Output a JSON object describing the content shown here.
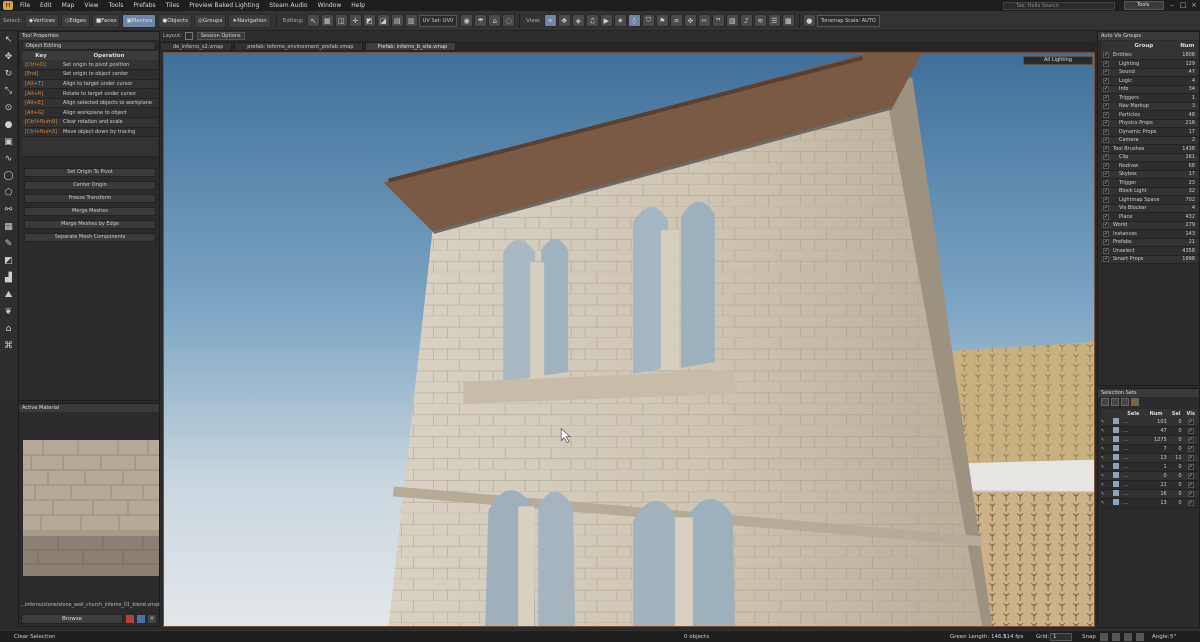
{
  "menu": {
    "items": [
      "File",
      "Edit",
      "Map",
      "View",
      "Tools",
      "Prefabs",
      "Tiles",
      "Preview Baked Lighting",
      "Steam Audio",
      "Window",
      "Help"
    ],
    "search_placeholder": "Tab: Hello Search",
    "tools_label": "Tools"
  },
  "toolbar": {
    "select_label": "Select:",
    "modes": [
      {
        "label": "Vertices",
        "icon": "vertex-icon"
      },
      {
        "label": "Edges",
        "icon": "edge-icon"
      },
      {
        "label": "Faces",
        "icon": "face-icon"
      },
      {
        "label": "Meshes",
        "icon": "mesh-icon",
        "active": true
      },
      {
        "label": "Objects",
        "icon": "object-icon"
      },
      {
        "label": "Groups",
        "icon": "group-icon"
      },
      {
        "label": "Navigation",
        "icon": "navigation-icon"
      }
    ],
    "editing_label": "Editing:",
    "uv_set": "UV Set: UV0",
    "view_label": "View:",
    "tonemap_label": "Tonemap Scale: AUTO"
  },
  "tool_properties": {
    "title": "Tool Properties",
    "section": "Object Editing",
    "col_key": "Key",
    "col_op": "Operation",
    "rows": [
      {
        "key": "[Ctrl+D]",
        "op": "Set origin to pivot position"
      },
      {
        "key": "[End]",
        "op": "Set origin to object center"
      },
      {
        "key": "[Alt+T]",
        "op": "Align to target under cursor"
      },
      {
        "key": "[Alt+R]",
        "op": "Rotate to target under cursor"
      },
      {
        "key": "[Alt+E]",
        "op": "Align selected objects to workplane"
      },
      {
        "key": "[Alt+G]",
        "op": "Align workplane to object"
      },
      {
        "key": "[Ctrl+Num9]",
        "op": "Clear rotation and scale"
      },
      {
        "key": "[Ctrl+Num3]",
        "op": "Move object down by tracing"
      }
    ],
    "buttons": [
      "Set Origin To Pivot",
      "Center Origin",
      "Freeze Transform",
      "Merge Meshes",
      "Merge Meshes by Edge",
      "Separate Mesh Components"
    ]
  },
  "active_material": {
    "title": "Active Material",
    "path": "...inferno/stone/stone_wall_church_inferno_01_blend.vmat",
    "browse": "Browse"
  },
  "viewport": {
    "layout_label": "Layout:",
    "session_options": "Session Options",
    "tabs": [
      "de_inferno_s2.vmap",
      "prefab: teferno_environment_prefab.vmap",
      "Prefab: inferno_b_site.vmap"
    ],
    "lighting": "All Lighting"
  },
  "auto_vis_groups": {
    "title": "Auto Vis Groups",
    "col_group": "Group",
    "col_num": "Num",
    "rows": [
      {
        "name": "Entities",
        "num": "1808",
        "indent": 0
      },
      {
        "name": "Lighting",
        "num": "129",
        "indent": 1
      },
      {
        "name": "Sound",
        "num": "47",
        "indent": 1
      },
      {
        "name": "Logic",
        "num": "4",
        "indent": 1
      },
      {
        "name": "Info",
        "num": "34",
        "indent": 1
      },
      {
        "name": "Triggers",
        "num": "1",
        "indent": 1
      },
      {
        "name": "Nav Markup",
        "num": "3",
        "indent": 1
      },
      {
        "name": "Particles",
        "num": "48",
        "indent": 1
      },
      {
        "name": "Physics Props",
        "num": "216",
        "indent": 1
      },
      {
        "name": "Dynamic Props",
        "num": "17",
        "indent": 1
      },
      {
        "name": "Camera",
        "num": "2",
        "indent": 1
      },
      {
        "name": "Tool Brushes",
        "num": "1438",
        "indent": 0
      },
      {
        "name": "Clip",
        "num": "161",
        "indent": 1
      },
      {
        "name": "Nodraw",
        "num": "68",
        "indent": 1
      },
      {
        "name": "Skybox",
        "num": "17",
        "indent": 1
      },
      {
        "name": "Trigger",
        "num": "23",
        "indent": 1
      },
      {
        "name": "Block Light",
        "num": "32",
        "indent": 1
      },
      {
        "name": "Lightmap Space",
        "num": "702",
        "indent": 1
      },
      {
        "name": "Vis Blocker",
        "num": "4",
        "indent": 1
      },
      {
        "name": "Place",
        "num": "432",
        "indent": 1
      },
      {
        "name": "World",
        "num": "279",
        "indent": 0
      },
      {
        "name": "Instances",
        "num": "143",
        "indent": 0
      },
      {
        "name": "Prefabs",
        "num": "21",
        "indent": 0
      },
      {
        "name": "Unselect",
        "num": "4358",
        "indent": 0
      },
      {
        "name": "Smart Props",
        "num": "1998",
        "indent": 0
      }
    ]
  },
  "selection_sets": {
    "title": "Selection Sets",
    "cols": [
      "Sele",
      "Num",
      "Sel",
      "Vis"
    ],
    "rows": [
      {
        "num": "103",
        "sel": "0"
      },
      {
        "num": "47",
        "sel": "0"
      },
      {
        "num": "1275",
        "sel": "0"
      },
      {
        "num": "7",
        "sel": "0"
      },
      {
        "num": "13",
        "sel": "11"
      },
      {
        "num": "1",
        "sel": "0"
      },
      {
        "num": "0",
        "sel": "0"
      },
      {
        "num": "22",
        "sel": "0"
      },
      {
        "num": "16",
        "sel": "0"
      },
      {
        "num": "13",
        "sel": "0"
      }
    ]
  },
  "status": {
    "left": "Clear Selection",
    "objects": "0 objects",
    "green_length": "Green Length: 146.5",
    "fps": "114 fps",
    "grid_label": "Grid:",
    "grid_value": "1",
    "snap_label": "Snap",
    "angle_label": "Angle:",
    "angle_value": "5°"
  }
}
